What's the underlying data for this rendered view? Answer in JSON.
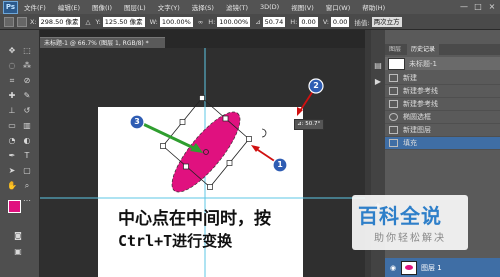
{
  "menubar": {
    "logo": "Ps",
    "items": [
      "文件(F)",
      "编辑(E)",
      "图像(I)",
      "图层(L)",
      "文字(Y)",
      "选择(S)",
      "滤镜(T)",
      "3D(D)",
      "视图(V)",
      "窗口(W)",
      "帮助(H)"
    ],
    "controls": [
      "—",
      "□",
      "×"
    ]
  },
  "options": {
    "x_label": "X:",
    "x_value": "298.50 像素",
    "y_label": "Y:",
    "y_value": "125.50 像素",
    "w_label": "W:",
    "w_value": "100.00%",
    "h_label": "H:",
    "h_value": "100.00%",
    "angle_value": "50.74",
    "hskew_label": "H:",
    "hskew_value": "0.00",
    "vskew_label": "V:",
    "vskew_value": "0.00",
    "interp_label": "插值:",
    "interp_value": "两次立方"
  },
  "document": {
    "tab_label": "未标题-1 @ 66.7% (图层 1, RGB/8) *"
  },
  "canvas": {
    "rotate_tip": "⊿: 50.7°",
    "callouts": [
      "1",
      "2",
      "3"
    ],
    "caption_line1": "中心点在中间时，按",
    "caption_line2": "Ctrl+T进行变换"
  },
  "watermark": {
    "title": "百科全说",
    "subtitle": "助你轻松解决"
  },
  "panel": {
    "tabs": [
      "图层",
      "历史记录"
    ],
    "snapshot_label": "未标题-1",
    "history": [
      "新建",
      "新建参考线",
      "新建参考线",
      "椭圆选框",
      "新建图层",
      "填充"
    ],
    "layer_name": "图层 1"
  },
  "colors": {
    "shape_fill": "#e0117f",
    "arrow_green": "#2f9e2f",
    "callout_blue": "#2f5db3",
    "guide_cyan": "#5ec7e6",
    "selection_blue": "#3f6ea5"
  }
}
